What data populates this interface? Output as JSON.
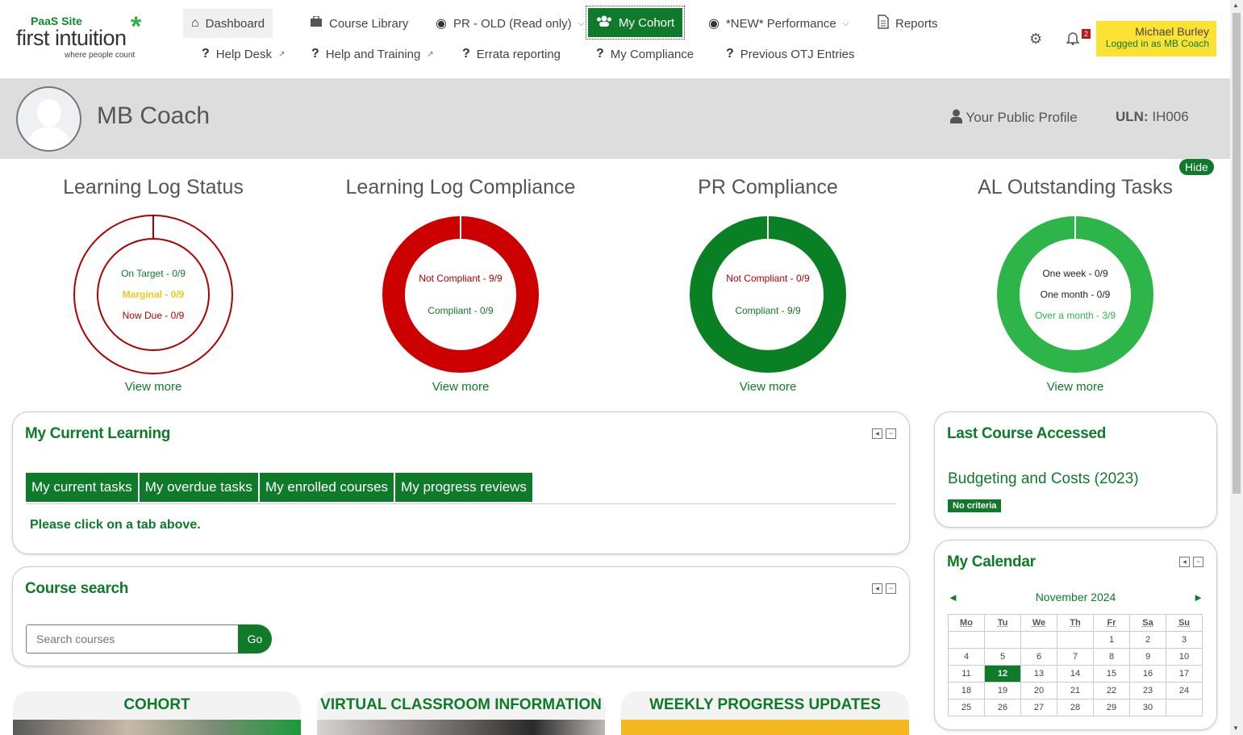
{
  "logo": {
    "brand": "PaaS Site",
    "name": "first intuition",
    "tagline": "where people count",
    "star": "*"
  },
  "nav": {
    "row1": [
      {
        "label": "Dashboard",
        "icon": "home-icon"
      },
      {
        "label": "Course Library",
        "icon": "briefcase-icon"
      },
      {
        "label": "PR - OLD (Read only)",
        "icon": "dashboard-icon"
      },
      {
        "label": "My Cohort",
        "icon": "users-icon"
      },
      {
        "label": "*NEW* Performance",
        "icon": "dashboard-icon"
      },
      {
        "label": "Reports",
        "icon": "document-icon"
      }
    ],
    "row2": [
      {
        "label": "Help Desk"
      },
      {
        "label": "Help and Training"
      },
      {
        "label": "Errata reporting"
      },
      {
        "label": "My Compliance"
      },
      {
        "label": "Previous OTJ Entries"
      }
    ]
  },
  "header": {
    "notifications": "2",
    "user_name": "Michael Burley",
    "logged_in": "Logged in as MB Coach"
  },
  "banner": {
    "name": "MB Coach",
    "public_profile": "Your Public Profile",
    "uln_label": "ULN:",
    "uln_value": "IH006"
  },
  "hide_label": "Hide",
  "donuts": [
    {
      "title": "Learning Log Status",
      "labels": [
        "On Target - 0/9",
        "Marginal - 0/9",
        "Now Due - 0/9"
      ],
      "view_more": "View more"
    },
    {
      "title": "Learning Log Compliance",
      "labels": [
        "Not Compliant - 9/9",
        "Compliant - 0/9"
      ],
      "view_more": "View more"
    },
    {
      "title": "PR Compliance",
      "labels": [
        "Not Compliant - 0/9",
        "Compliant - 9/9"
      ],
      "view_more": "View more"
    },
    {
      "title": "AL Outstanding Tasks",
      "labels": [
        "One week - 0/9",
        "One month - 0/9",
        "Over a month - 3/9"
      ],
      "view_more": "View more"
    }
  ],
  "current_learning": {
    "title": "My Current Learning",
    "tabs": [
      "My current tasks",
      "My overdue tasks",
      "My enrolled courses",
      "My progress reviews"
    ],
    "message": "Please click on a tab above."
  },
  "course_search": {
    "title": "Course search",
    "placeholder": "Search courses",
    "go": "Go"
  },
  "last_course": {
    "title": "Last Course Accessed",
    "course": "Budgeting and Costs (2023)",
    "badge": "No criteria"
  },
  "calendar": {
    "title": "My Calendar",
    "month": "November 2024",
    "prev": "◄",
    "next": "►",
    "days": [
      "Mo",
      "Tu",
      "We",
      "Th",
      "Fr",
      "Sa",
      "Su"
    ],
    "weeks": [
      [
        "",
        "",
        "",
        "",
        "1",
        "2",
        "3"
      ],
      [
        "4",
        "5",
        "6",
        "7",
        "8",
        "9",
        "10"
      ],
      [
        "11",
        "12",
        "13",
        "14",
        "15",
        "16",
        "17"
      ],
      [
        "18",
        "19",
        "20",
        "21",
        "22",
        "23",
        "24"
      ],
      [
        "25",
        "26",
        "27",
        "28",
        "29",
        "30",
        ""
      ]
    ],
    "today": "12"
  },
  "tiles": [
    "COHORT",
    "VIRTUAL CLASSROOM INFORMATION",
    "WEEKLY PROGRESS UPDATES"
  ],
  "colors": {
    "green": "#0f7a2a",
    "red": "#cc0000",
    "light_green": "#2db54a",
    "yellow": "#fce232"
  }
}
